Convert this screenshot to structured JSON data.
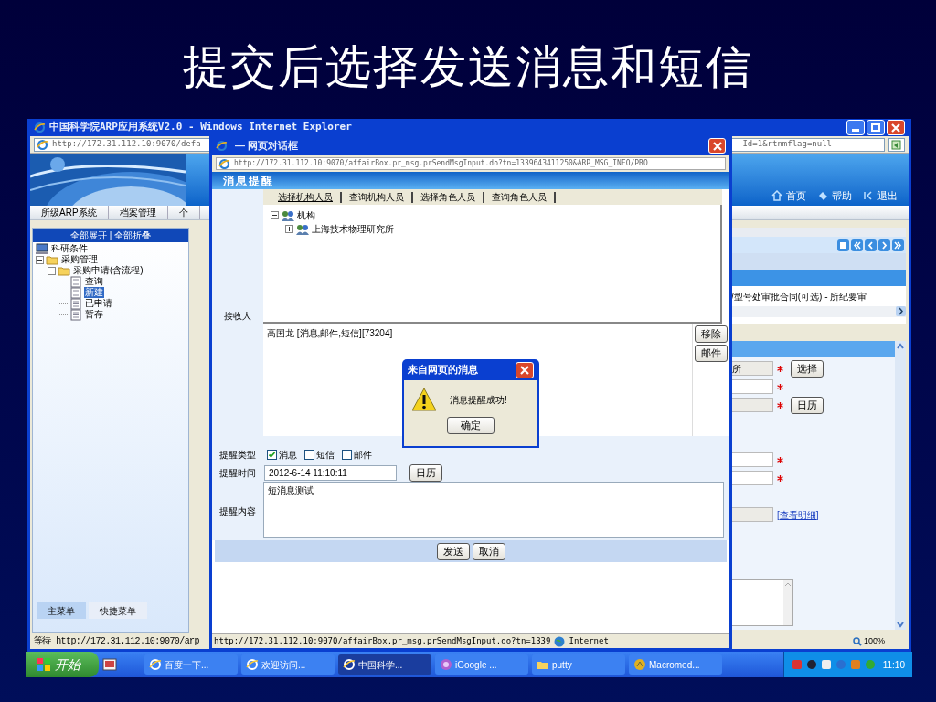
{
  "slide_title": "提交后选择发送消息和短信",
  "ie_window": {
    "title": "中国科学院ARP应用系统V2.0 - Windows Internet Explorer",
    "address_left": "http://172.31.112.10:9070/defa",
    "address_right": "Id=1&rtnmflag=null",
    "menu_tabs": [
      "所级ARP系统",
      "档案管理",
      "个"
    ],
    "header_links": [
      {
        "label": "首页",
        "kind": "home"
      },
      {
        "label": "帮助",
        "kind": "help"
      },
      {
        "label": "退出",
        "kind": "exit"
      }
    ],
    "sidebar": {
      "header": "全部展开 | 全部折叠",
      "tree": [
        {
          "label": "科研条件",
          "kind": "computer",
          "selected": false
        },
        {
          "label": "采购管理",
          "kind": "folder",
          "expanded": true,
          "selected": false,
          "children": [
            {
              "label": "采购申请(含流程)",
              "kind": "folder",
              "expanded": true,
              "selected": false,
              "children": [
                {
                  "label": "查询",
                  "kind": "page",
                  "selected": false
                },
                {
                  "label": "新建",
                  "kind": "page",
                  "selected": true
                },
                {
                  "label": "已申请",
                  "kind": "page",
                  "selected": false
                },
                {
                  "label": "暂存",
                  "kind": "page",
                  "selected": false
                }
              ]
            }
          ]
        }
      ],
      "bottom_tabs": [
        {
          "label": "主菜单",
          "selected": true
        },
        {
          "label": "快捷菜单",
          "selected": false
        }
      ]
    },
    "content": {
      "breadcrumb": "/型号处审批合同(可选) - 所纪要审",
      "fields": [
        {
          "value": "所",
          "readonly": true,
          "required": true,
          "button": "选择"
        },
        {
          "readonly": false,
          "required": true
        },
        {
          "readonly": true,
          "required": true,
          "button": "日历"
        },
        {
          "readonly": false,
          "required": true
        },
        {
          "readonly": false,
          "required": true
        },
        {
          "readonly": true,
          "required": false,
          "link": "[查看明细]"
        }
      ]
    },
    "status_left": "等待 http://172.31.112.10:9070/arp",
    "zoom": "100%"
  },
  "dialog": {
    "title": "— 网页对话框",
    "address": "http://172.31.112.10:9070/affairBox.pr_msg.prSendMsgInput.do?tn=1339643411250&ARP_MSG_INFO/PRO",
    "heading": "消息提醒",
    "tabs": [
      {
        "label": "选择机构人员",
        "selected": true
      },
      {
        "label": "查询机构人员",
        "selected": false
      },
      {
        "label": "选择角色人员",
        "selected": false
      },
      {
        "label": "查询角色人员",
        "selected": false
      }
    ],
    "org_tree": {
      "label": "机构",
      "expanded": true,
      "children": [
        {
          "label": "上海技术物理研究所",
          "expanded": false
        }
      ]
    },
    "recipient_label": "接收人",
    "recipients": "高国龙 [消息,邮件,短信][73204]",
    "side_buttons": [
      "移除",
      "邮件"
    ],
    "type_label": "提醒类型",
    "types": [
      {
        "label": "消息",
        "checked": true
      },
      {
        "label": "短信",
        "checked": false
      },
      {
        "label": "邮件",
        "checked": false
      }
    ],
    "time_label": "提醒时间",
    "time_value": "2012-6-14 11:10:11",
    "calendar_button": "日历",
    "content_label": "提醒内容",
    "content_value": "短消息测试",
    "buttons": [
      "发送",
      "取消"
    ],
    "status_url": "http://172.31.112.10:9070/affairBox.pr_msg.prSendMsgInput.do?tn=1339",
    "status_zone": "Internet"
  },
  "alert": {
    "title": "来自网页的消息",
    "message": "消息提醒成功!",
    "button": "确定"
  },
  "taskbar": {
    "start": "开始",
    "tasks": [
      {
        "label": "百度一下...",
        "kind": "ie",
        "selected": false
      },
      {
        "label": "欢迎访问...",
        "kind": "ie",
        "selected": false
      },
      {
        "label": "中国科学...",
        "kind": "ie",
        "selected": true
      },
      {
        "label": "iGoogle ...",
        "kind": "google",
        "selected": false
      },
      {
        "label": "putty",
        "kind": "folder",
        "selected": false
      },
      {
        "label": "Macromed...",
        "kind": "app",
        "selected": false
      }
    ],
    "clock": "11:10"
  }
}
